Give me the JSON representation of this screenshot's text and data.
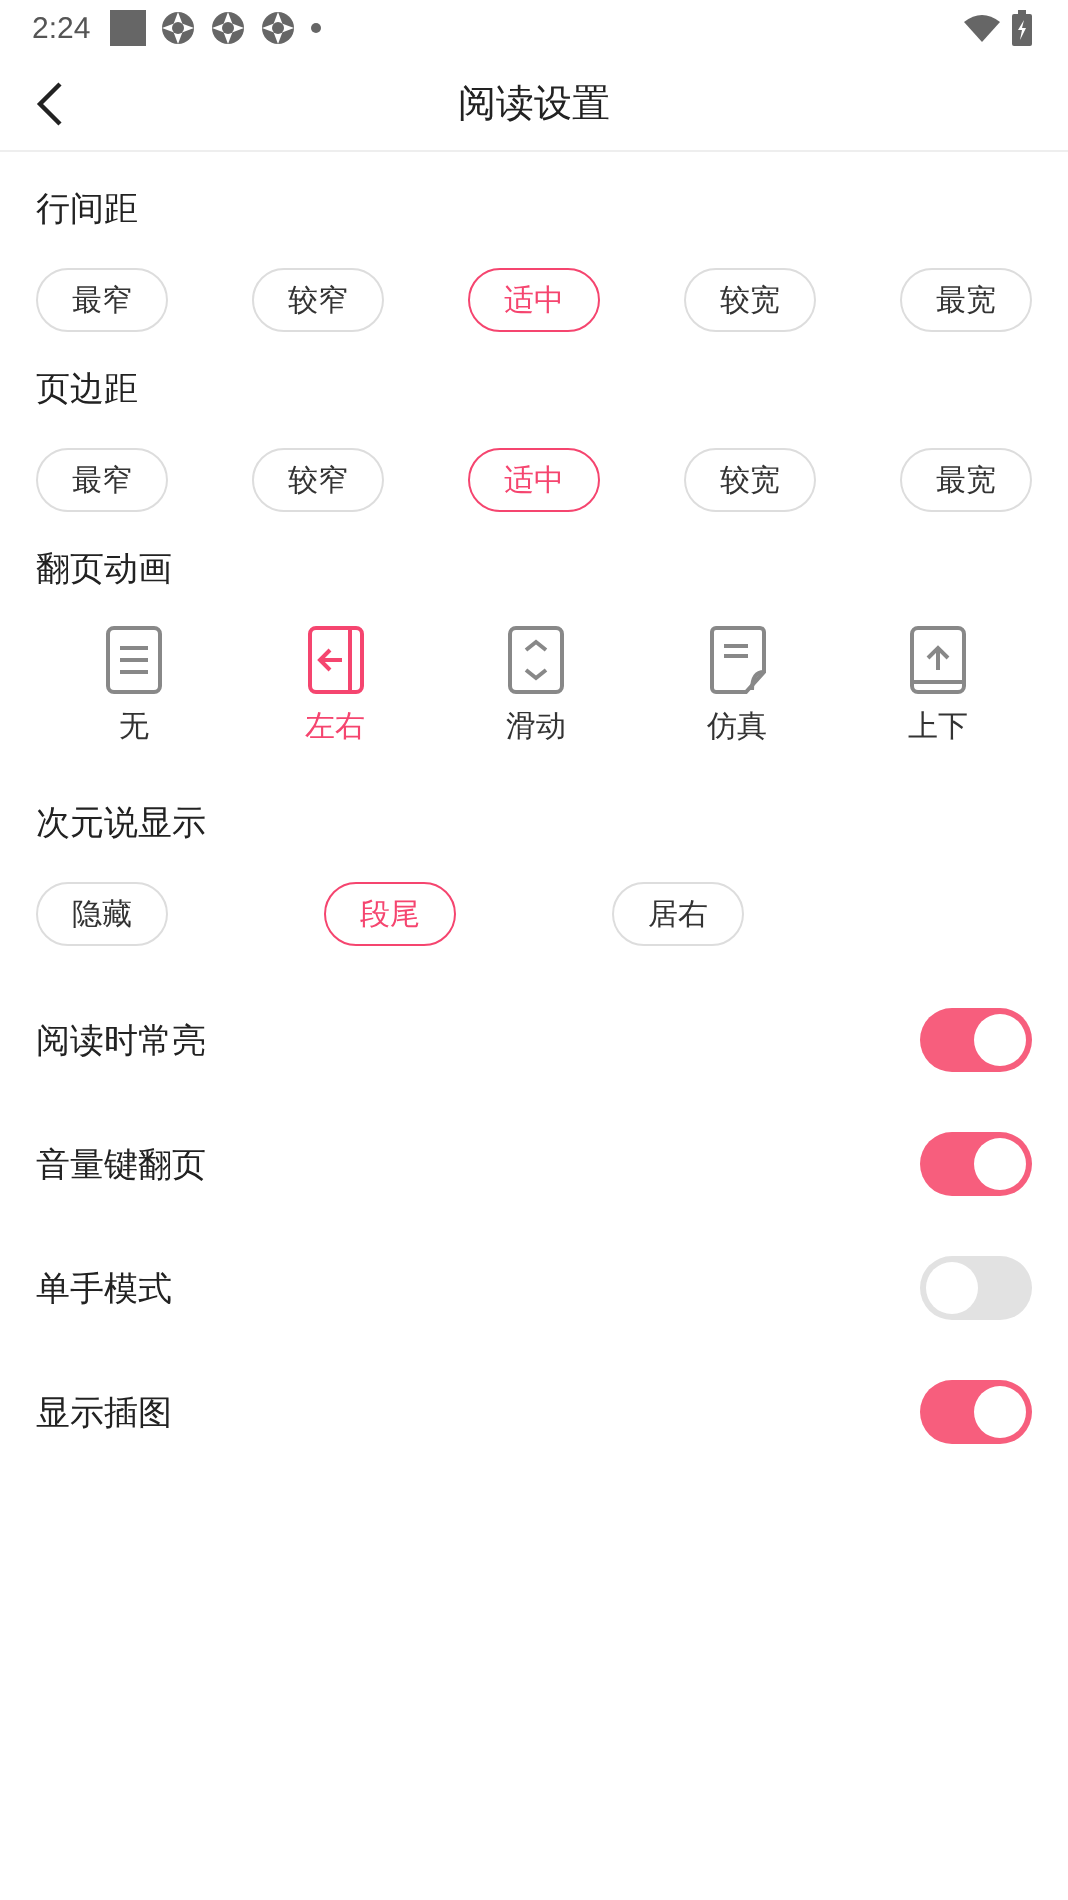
{
  "status_bar": {
    "time": "2:24"
  },
  "header": {
    "title": "阅读设置"
  },
  "spacing_groups": [
    {
      "label": "行间距",
      "options": [
        {
          "label": "最窄",
          "selected": false
        },
        {
          "label": "较窄",
          "selected": false
        },
        {
          "label": "适中",
          "selected": true
        },
        {
          "label": "较宽",
          "selected": false
        },
        {
          "label": "最宽",
          "selected": false
        }
      ]
    },
    {
      "label": "页边距",
      "options": [
        {
          "label": "最窄",
          "selected": false
        },
        {
          "label": "较窄",
          "selected": false
        },
        {
          "label": "适中",
          "selected": true
        },
        {
          "label": "较宽",
          "selected": false
        },
        {
          "label": "最宽",
          "selected": false
        }
      ]
    }
  ],
  "page_animation": {
    "label": "翻页动画",
    "options": [
      {
        "label": "无",
        "kind": "none",
        "selected": false
      },
      {
        "label": "左右",
        "kind": "horizontal",
        "selected": true
      },
      {
        "label": "滑动",
        "kind": "scroll",
        "selected": false
      },
      {
        "label": "仿真",
        "kind": "curl",
        "selected": false
      },
      {
        "label": "上下",
        "kind": "vertical",
        "selected": false
      }
    ]
  },
  "display": {
    "label": "次元说显示",
    "options": [
      {
        "label": "隐藏",
        "selected": false
      },
      {
        "label": "段尾",
        "selected": true
      },
      {
        "label": "居右",
        "selected": false
      }
    ]
  },
  "toggles": [
    {
      "label": "阅读时常亮",
      "on": true
    },
    {
      "label": "音量键翻页",
      "on": true
    },
    {
      "label": "单手模式",
      "on": false
    },
    {
      "label": "显示插图",
      "on": true
    }
  ]
}
